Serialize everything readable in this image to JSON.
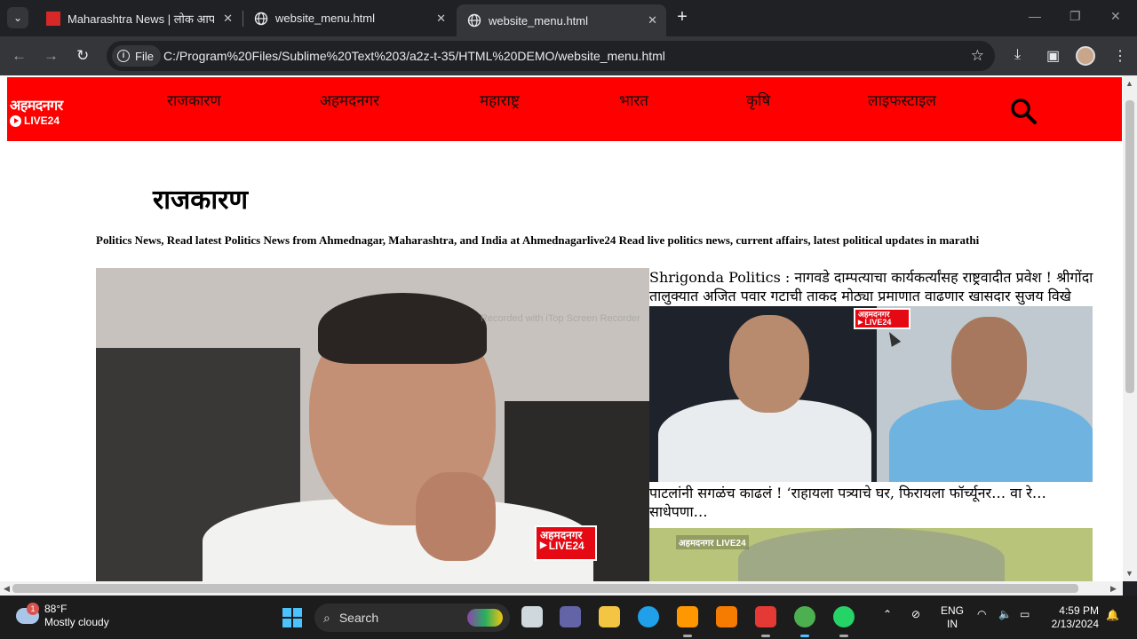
{
  "browser": {
    "tabs": [
      {
        "title": "Maharashtra News | लोक आपला",
        "active": false
      },
      {
        "title": "website_menu.html",
        "active": false
      },
      {
        "title": "website_menu.html",
        "active": true
      }
    ],
    "file_chip": "File",
    "url": "C:/Program%20Files/Sublime%20Text%203/a2z-t-35/HTML%20DEMO/website_menu.html"
  },
  "site": {
    "logo_line1": "अहमदनगर",
    "logo_line2": "LIVE24",
    "menu": [
      "राजकारण",
      "अहमदनगर",
      "महाराष्ट्र",
      "भारत",
      "कृषि",
      "लाइफस्टाइल"
    ],
    "page_title": "राजकारण",
    "page_description": "Politics News, Read latest Politics News from Ahmednagar, Maharashtra, and India at Ahmednagarlive24 Read live politics news, current affairs, latest political updates in marathi",
    "hero_badge_line1": "अहमदनगर",
    "hero_badge_line2": "LIVE24",
    "watermark": "Recorded with iTop Screen Recorder",
    "side_news": [
      {
        "title": "Shrigonda Politics : नागवडे दाम्पत्याचा कार्यकर्त्यांसह राष्ट्रवादीत प्रवेश ! श्रीगोंदा तालुक्यात अजित पवार गटाची ताकद मोठ्या प्रमाणात वाढणार खासदार सुजय विखे",
        "badge_line1": "अहमदनगर",
        "badge_line2": "LIVE24"
      },
      {
        "title": "पाटलांनी सगळंच काढलं ! ‘राहायला पत्र्याचे घर, फिरायला फॉर्च्यूनर… वा रे… साधेपणा…",
        "badge": "अहमदनगर LIVE24"
      }
    ]
  },
  "taskbar": {
    "weather_badge": "1",
    "temperature": "88°F",
    "condition": "Mostly cloudy",
    "search_label": "Search",
    "lang_line1": "ENG",
    "lang_line2": "IN",
    "time": "4:59 PM",
    "date": "2/13/2024"
  },
  "colors": {
    "header_red": "#ff0000",
    "badge_red": "#e50914"
  }
}
